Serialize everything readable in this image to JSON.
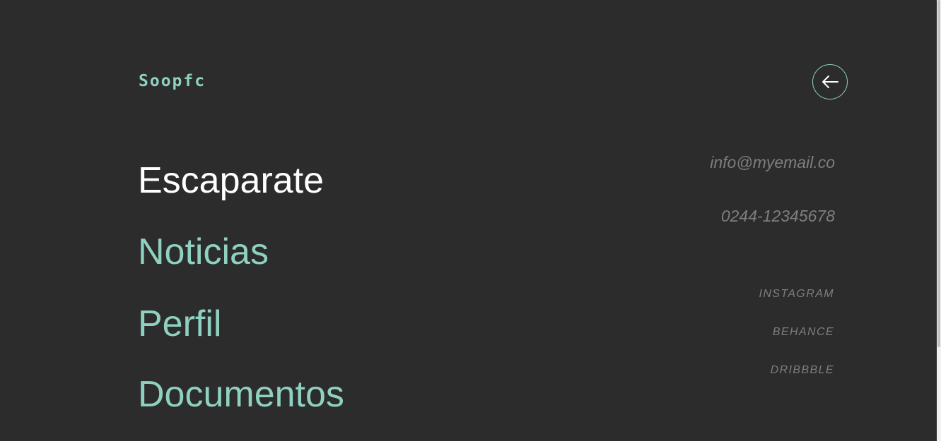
{
  "colors": {
    "background": "#2c2c2c",
    "accent": "#8fd1c0",
    "active": "#ffffff",
    "muted": "#7e7e7e"
  },
  "header": {
    "logo": "Soopfc",
    "close_icon": "arrow-left-icon"
  },
  "nav": {
    "items": [
      {
        "label": "Escaparate",
        "active": true
      },
      {
        "label": "Noticias",
        "active": false
      },
      {
        "label": "Perfil",
        "active": false
      },
      {
        "label": "Documentos",
        "active": false
      }
    ]
  },
  "contact": {
    "email": "info@myemail.co",
    "phone": "0244-12345678"
  },
  "social": {
    "items": [
      {
        "label": "INSTAGRAM"
      },
      {
        "label": "BEHANCE"
      },
      {
        "label": "DRIBBBLE"
      }
    ]
  }
}
